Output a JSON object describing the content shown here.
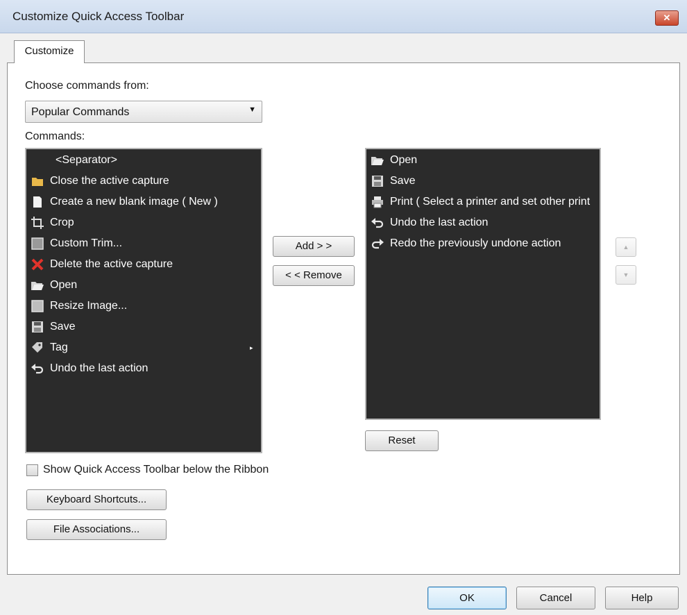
{
  "window": {
    "title": "Customize Quick Access Toolbar",
    "close_label": "✕"
  },
  "tab": {
    "label": "Customize"
  },
  "choose": {
    "label": "Choose commands from:",
    "selected": "Popular Commands"
  },
  "commands": {
    "label": "Commands:",
    "items": [
      {
        "label": "<Separator>",
        "icon": "none"
      },
      {
        "label": "Close the active capture",
        "icon": "folder-icon"
      },
      {
        "label": "Create a new blank image ( New )",
        "icon": "blank-page-icon"
      },
      {
        "label": "Crop",
        "icon": "crop-icon"
      },
      {
        "label": "Custom Trim...",
        "icon": "trim-icon"
      },
      {
        "label": "Delete the active capture",
        "icon": "delete-x-icon"
      },
      {
        "label": "Open",
        "icon": "open-folder-icon"
      },
      {
        "label": "Resize Image...",
        "icon": "resize-icon"
      },
      {
        "label": "Save",
        "icon": "floppy-disk-icon"
      },
      {
        "label": "Tag",
        "icon": "tag-icon",
        "submenu": "▸"
      },
      {
        "label": "Undo the last action",
        "icon": "undo-icon"
      }
    ]
  },
  "buttons": {
    "add": "Add > >",
    "remove": "< < Remove",
    "up": "▲",
    "down": "▼",
    "reset": "Reset"
  },
  "toolbar_list": {
    "items": [
      {
        "label": "Open",
        "icon": "open-folder-icon"
      },
      {
        "label": "Save",
        "icon": "floppy-disk-icon"
      },
      {
        "label": "Print ( Select a printer and set other print",
        "icon": "printer-icon"
      },
      {
        "label": "Undo the last action",
        "icon": "undo-icon"
      },
      {
        "label": "Redo the previously undone action",
        "icon": "redo-icon"
      }
    ]
  },
  "show_below": {
    "label": "Show Quick Access Toolbar below the Ribbon",
    "checked": false
  },
  "bottom_buttons": {
    "keyboard": "Keyboard Shortcuts...",
    "file_assoc": "File Associations..."
  },
  "footer": {
    "ok": "OK",
    "cancel": "Cancel",
    "help": "Help"
  }
}
